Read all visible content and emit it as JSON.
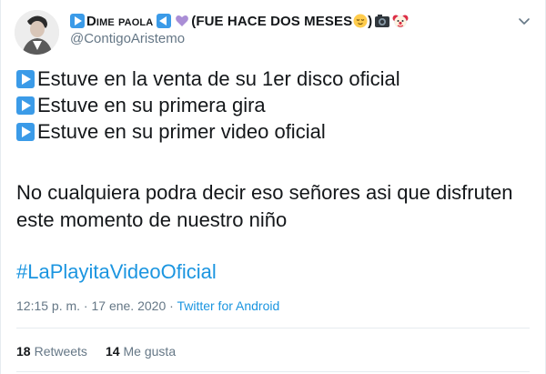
{
  "tweet": {
    "display_name_part1": "Dime paola",
    "display_name_part2": "(FUE HACE DOS MESES",
    "display_name_close": ")",
    "handle": "@ContigoAristemo",
    "lines": [
      "Estuve en la venta de su 1er disco oficial",
      "Estuve en su primera gira",
      "Estuve en su primer video oficial"
    ],
    "paragraph": "No cualquiera podra decir eso señores asi que disfruten este momento de nuestro niño",
    "hashtag": "#LaPlayitaVideoOficial",
    "timestamp": "12:15 p. m. · 17 ene. 2020",
    "separator": " · ",
    "source": "Twitter for Android",
    "retweets_count": "18",
    "retweets_label": "Retweets",
    "likes_count": "14",
    "likes_label": "Me gusta"
  },
  "icons": {
    "play": "play-button-emoji",
    "reverse": "reverse-button-emoji",
    "heart": "purple-heart-emoji",
    "relieved": "relieved-face-emoji",
    "camera": "camera-flash-emoji",
    "clown": "clown-face-emoji",
    "menu": "chevron-down-icon"
  },
  "colors": {
    "link": "#1b95e0",
    "muted": "#657786",
    "text": "#14171a",
    "emoji_blue": "#3b9be8"
  }
}
